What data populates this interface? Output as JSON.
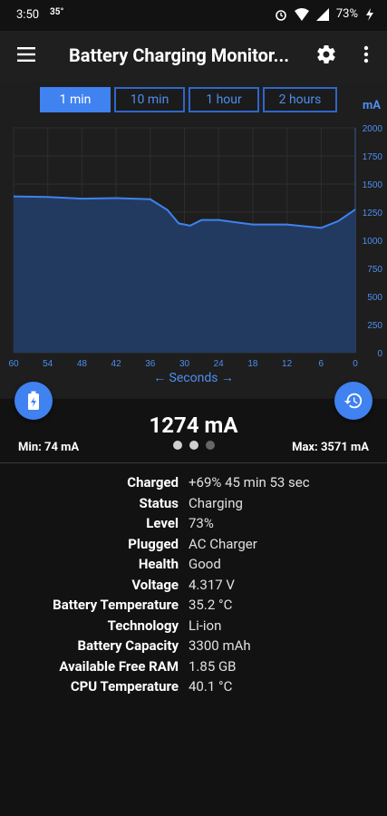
{
  "status_bar": {
    "time": "3:50",
    "temp": "35°",
    "battery": "73%"
  },
  "app_bar": {
    "title": "Battery Charging Monitor..."
  },
  "tabs": [
    {
      "label": "1 min",
      "active": true
    },
    {
      "label": "10 min",
      "active": false
    },
    {
      "label": "1 hour",
      "active": false
    },
    {
      "label": "2 hours",
      "active": false
    }
  ],
  "graph": {
    "unit": "mA",
    "x_axis_label": "← Seconds →"
  },
  "chart_data": {
    "type": "area",
    "x": [
      60,
      54,
      48,
      42,
      36,
      33,
      31,
      29,
      27,
      24,
      18,
      12,
      6,
      3,
      0
    ],
    "y": [
      1390,
      1385,
      1370,
      1375,
      1365,
      1270,
      1150,
      1130,
      1180,
      1180,
      1140,
      1140,
      1110,
      1170,
      1274
    ],
    "xticks": [
      60,
      54,
      48,
      42,
      36,
      30,
      24,
      18,
      12,
      6,
      0
    ],
    "yticks": [
      0,
      250,
      500,
      750,
      1000,
      1250,
      1500,
      1750,
      2000
    ],
    "xlim": [
      60,
      0
    ],
    "ylim": [
      0,
      2000
    ],
    "ylabel": "mA",
    "xlabel": "← Seconds →",
    "color": "#3f82f0",
    "fill": "#233a60"
  },
  "current": {
    "value": "1274 mA",
    "min": "Min: 74 mA",
    "max": "Max: 3571 mA"
  },
  "info": [
    {
      "label": "Charged",
      "value": "+69%  45 min 53 sec"
    },
    {
      "label": "Status",
      "value": "Charging"
    },
    {
      "label": "Level",
      "value": "73%"
    },
    {
      "label": "Plugged",
      "value": "AC Charger"
    },
    {
      "label": "Health",
      "value": "Good"
    },
    {
      "label": "Voltage",
      "value": "4.317 V"
    },
    {
      "label": "Battery Temperature",
      "value": "35.2 °C"
    },
    {
      "label": "Technology",
      "value": "Li-ion"
    },
    {
      "label": "Battery Capacity",
      "value": "3300 mAh"
    },
    {
      "label": "Available Free RAM",
      "value": "1.85 GB"
    },
    {
      "label": "CPU Temperature",
      "value": "40.1 °C"
    }
  ]
}
